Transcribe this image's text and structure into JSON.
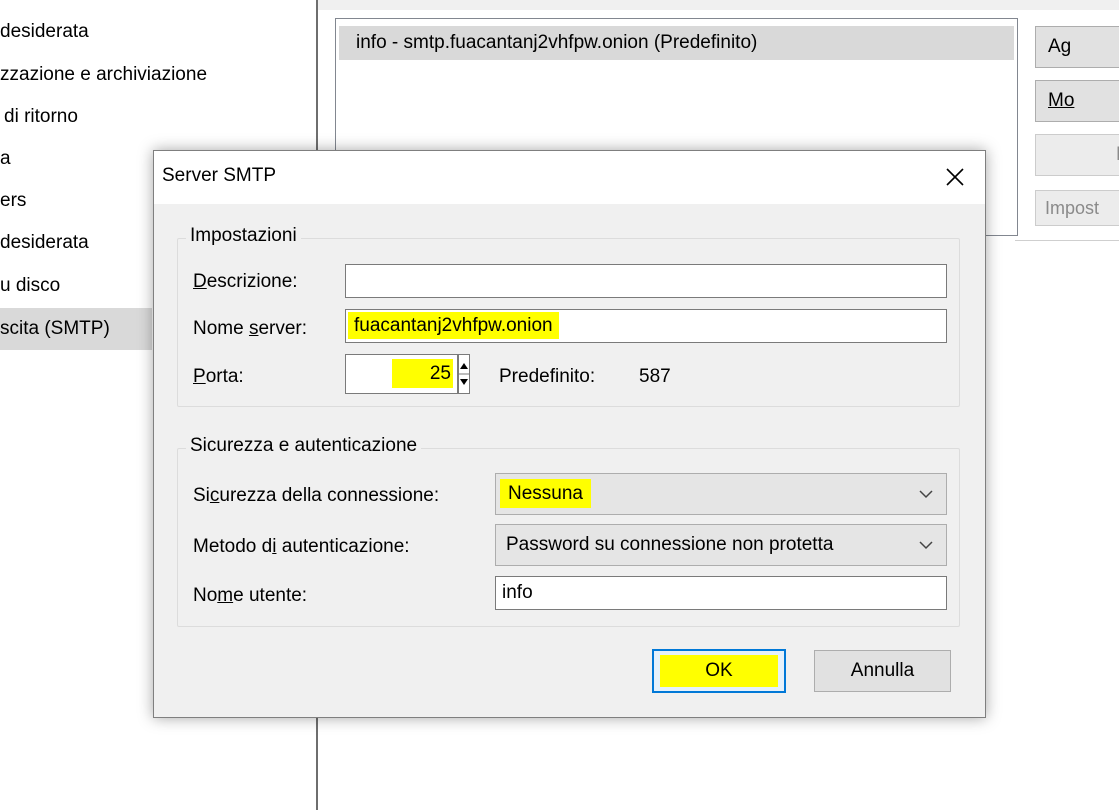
{
  "sidebar": {
    "items": [
      {
        "label": "desiderata"
      },
      {
        "label": "zzazione e archiviazione"
      },
      {
        "label": "di ritorno"
      },
      {
        "label": "a"
      },
      {
        "label": "ers"
      },
      {
        "label": "desiderata"
      },
      {
        "label": "u disco"
      },
      {
        "label": "scita (SMTP)"
      }
    ]
  },
  "server_list": {
    "rows": [
      {
        "label": "info - smtp.fuacantanj2vhfpw.onion (Predefinito)"
      }
    ]
  },
  "side_buttons": {
    "add": "Ag",
    "edit": "Mo",
    "remove": "E",
    "default": "Impost"
  },
  "dialog": {
    "title": "Server SMTP",
    "settings": {
      "legend": "Impostazioni",
      "description_label_pre": "",
      "description_label_ul": "D",
      "description_label_post": "escrizione:",
      "description_value": "",
      "server_label_pre": "Nome ",
      "server_label_ul": "s",
      "server_label_post": "erver:",
      "server_value": "fuacantanj2vhfpw.onion",
      "port_label_pre": "",
      "port_label_ul": "P",
      "port_label_post": "orta:",
      "port_value": "25",
      "default_label": "Predefinito:",
      "default_value": "587"
    },
    "security": {
      "legend": "Sicurezza e autenticazione",
      "connection_label_pre": "Si",
      "connection_label_ul": "c",
      "connection_label_post": "urezza della connessione:",
      "connection_value": "Nessuna",
      "auth_label_pre": "Metodo d",
      "auth_label_ul": "i",
      "auth_label_post": " autenticazione:",
      "auth_value": "Password su connessione non protetta",
      "username_label_pre": "No",
      "username_label_ul": "m",
      "username_label_post": "e utente:",
      "username_value": "info"
    },
    "ok_label": "OK",
    "cancel_label": "Annulla"
  },
  "colors": {
    "highlight": "#ffff00",
    "focus_border": "#0078d7",
    "dialog_bg": "#f0f0f0"
  }
}
